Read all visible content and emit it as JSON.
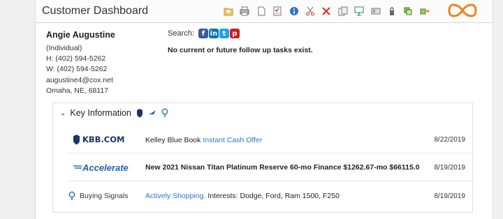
{
  "header": {
    "title": "Customer Dashboard"
  },
  "toolbar": {
    "icons": [
      "folder-note-icon",
      "print-icon",
      "document-icon",
      "checklist-icon",
      "info-icon",
      "scissors-icon",
      "delete-icon",
      "copy-icon",
      "presentation-icon",
      "card-icon",
      "lock-icon",
      "layers-icon",
      "transfer-icon"
    ],
    "brand_icon": "infinity-logo-icon"
  },
  "contact": {
    "name": "Angie Augustine",
    "type": "(Individual)",
    "home_phone": "H: (402) 594-5262",
    "work_phone": "W: (402) 594-5262",
    "email": "augustine4@cox.net",
    "location": "Omaha, NE, 68117"
  },
  "search": {
    "label": "Search:",
    "social": [
      "facebook-icon",
      "linkedin-icon",
      "twitter-icon",
      "pinterest-icon"
    ]
  },
  "tasks": {
    "message": "No current or future follow up tasks exist."
  },
  "key_info": {
    "title": "Key Information",
    "rows": [
      {
        "source": "KBB.COM",
        "prefix": "Kelley Blue Book",
        "link": "Instant Cash Offer",
        "date": "8/22/2019"
      },
      {
        "source": "Accelerate",
        "text": "New 2021 Nissan Titan Platinum Reserve 60-mo Finance $1262.67-mo $66115.0",
        "date": "8/19/2019"
      },
      {
        "source": "Buying Signals",
        "link": "Actively Shopping.",
        "suffix": "Interests: Dodge, Ford, Ram 1500, F250",
        "date": "8/19/2019"
      }
    ]
  },
  "colors": {
    "link": "#2b77c9",
    "brand_loop": "#e8871e",
    "accelerate": "#1f62b4",
    "kbb": "#1b3667"
  }
}
